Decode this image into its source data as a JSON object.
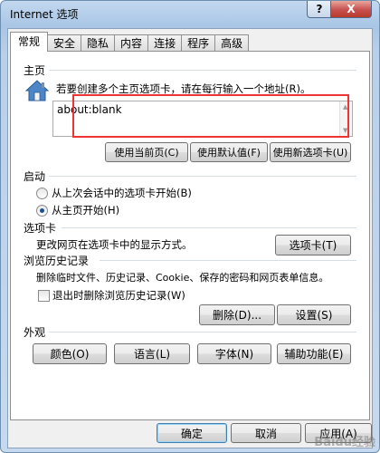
{
  "window": {
    "title": "Internet 选项",
    "help_label": "?",
    "close_label": "X"
  },
  "tabs": [
    {
      "label": "常规",
      "active": true
    },
    {
      "label": "安全"
    },
    {
      "label": "隐私"
    },
    {
      "label": "内容"
    },
    {
      "label": "连接"
    },
    {
      "label": "程序"
    },
    {
      "label": "高级"
    }
  ],
  "home": {
    "section_label": "主页",
    "description": "若要创建多个主页选项卡，请在每行输入一个地址(R)。",
    "url_value": "about:blank",
    "btn_current": "使用当前页(C)",
    "btn_default": "使用默认值(F)",
    "btn_newtab": "使用新选项卡(U)"
  },
  "startup": {
    "section_label": "启动",
    "option_last": "从上次会话中的选项卡开始(B)",
    "option_home": "从主页开始(H)",
    "selected": "option_home"
  },
  "tabs_section": {
    "section_label": "选项卡",
    "description": "更改网页在选项卡中的显示方式。",
    "button": "选项卡(T)"
  },
  "history": {
    "section_label": "浏览历史记录",
    "description": "删除临时文件、历史记录、Cookie、保存的密码和网页表单信息。",
    "checkbox_label": "退出时删除浏览历史记录(W)",
    "checkbox_checked": false,
    "btn_delete": "删除(D)...",
    "btn_settings": "设置(S)"
  },
  "appearance": {
    "section_label": "外观",
    "btn_colors": "颜色(O)",
    "btn_languages": "语言(L)",
    "btn_fonts": "字体(N)",
    "btn_accessibility": "辅助功能(E)"
  },
  "footer": {
    "ok": "确定",
    "cancel": "取消",
    "apply": "应用(A)",
    "watermark": "Baidu经验"
  },
  "colors": {
    "highlight_box": "#ee3333",
    "title_bar": "#b9d0ea"
  }
}
